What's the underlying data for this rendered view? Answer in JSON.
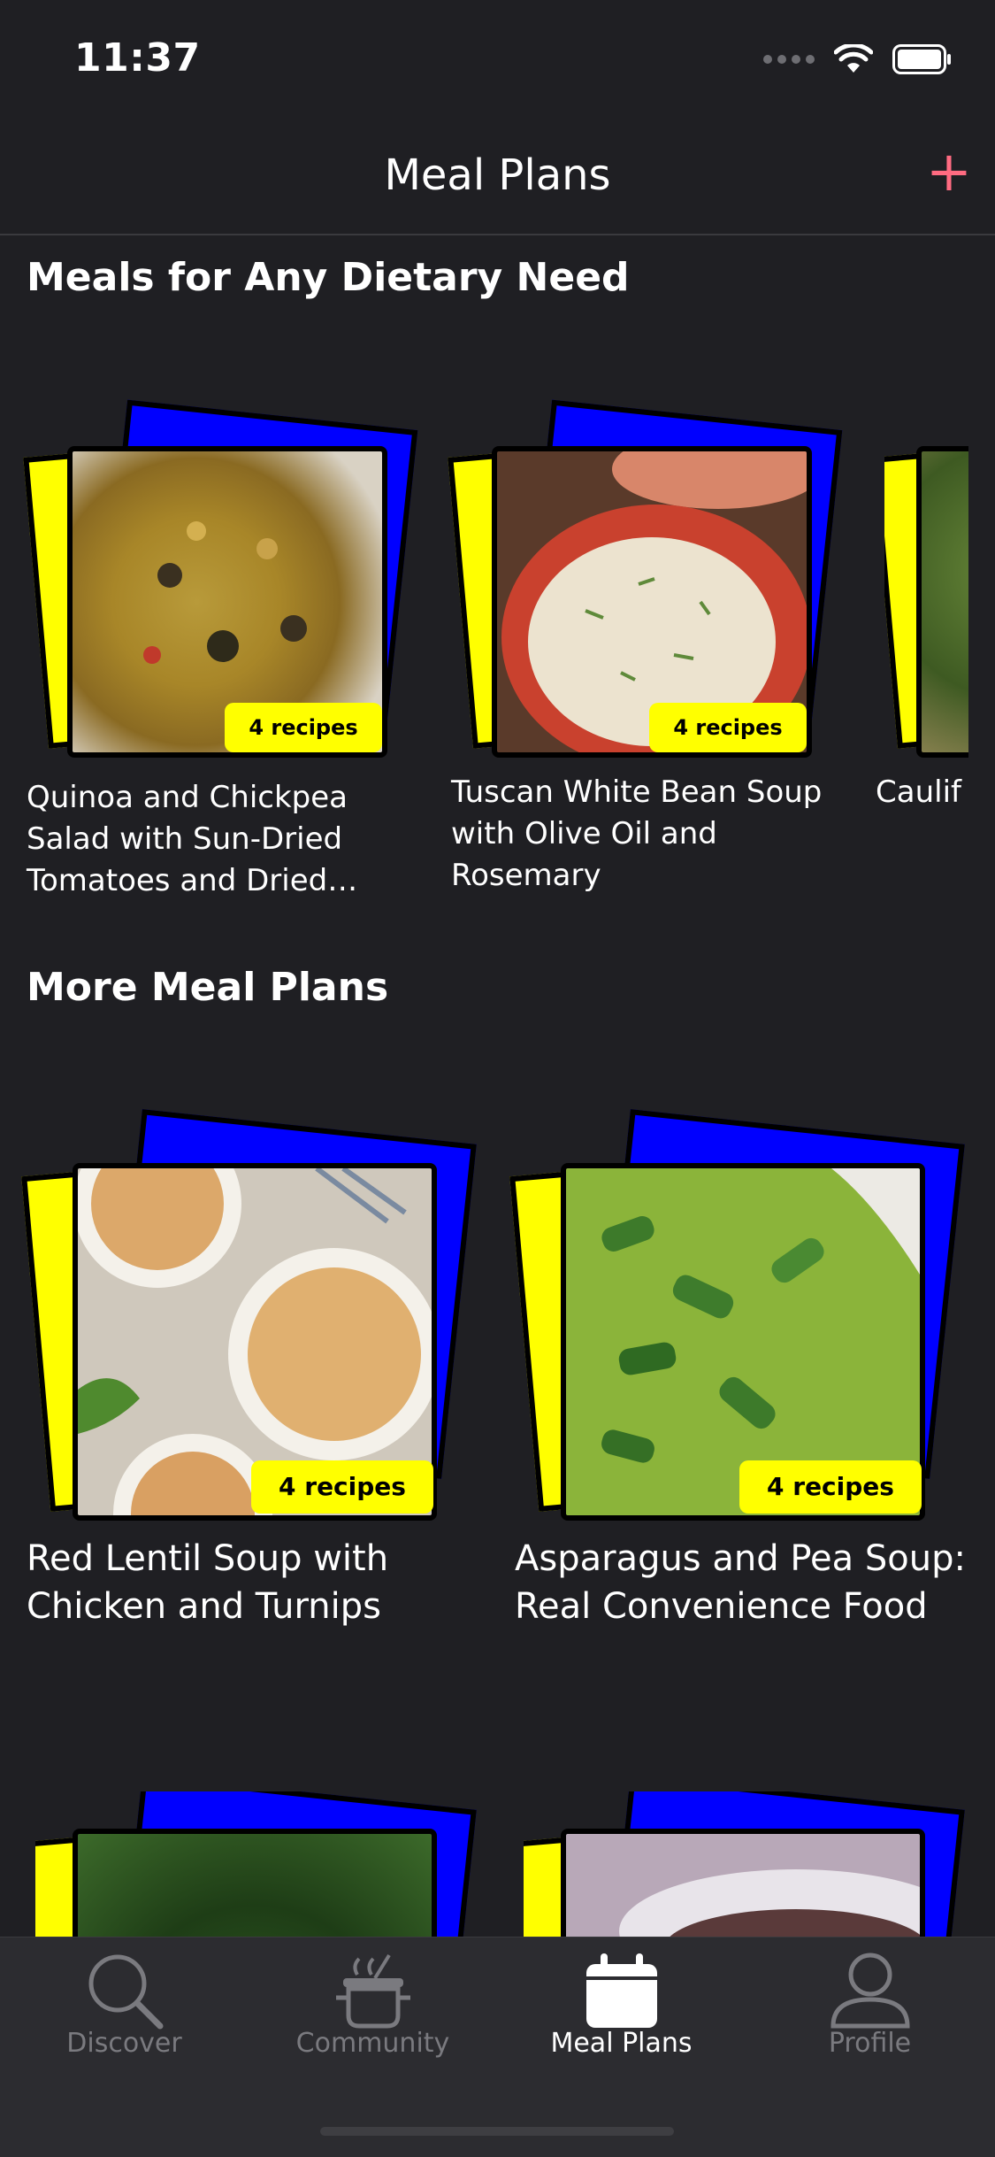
{
  "status": {
    "time": "11:37"
  },
  "nav": {
    "title": "Meal Plans",
    "add_label": "+"
  },
  "sections": [
    {
      "title": "Meals for Any Dietary Need",
      "cards": [
        {
          "title": "Quinoa and Chickpea Salad with Sun-Dried Tomatoes and Dried…",
          "badge": "4 recipes"
        },
        {
          "title": "Tuscan White Bean Soup with Olive Oil and Rosemary",
          "badge": "4 recipes"
        },
        {
          "title": "Caulif and Ve",
          "badge": ""
        }
      ]
    },
    {
      "title": "More Meal Plans",
      "cards": [
        {
          "title": "Red Lentil Soup with Chicken and Turnips",
          "badge": "4 recipes"
        },
        {
          "title": "Asparagus and Pea Soup: Real Convenience Food",
          "badge": "4 recipes"
        },
        {
          "title": "",
          "badge": ""
        },
        {
          "title": "",
          "badge": ""
        }
      ]
    }
  ],
  "tabs": [
    {
      "label": "Discover",
      "icon": "search-icon"
    },
    {
      "label": "Community",
      "icon": "pot-icon"
    },
    {
      "label": "Meal Plans",
      "icon": "calendar-icon",
      "active": true
    },
    {
      "label": "Profile",
      "icon": "person-icon"
    }
  ],
  "colors": {
    "accent": "#ff6b81",
    "badge": "#ffff00",
    "paper_blue": "#0000ff",
    "background": "#1f1f23"
  }
}
